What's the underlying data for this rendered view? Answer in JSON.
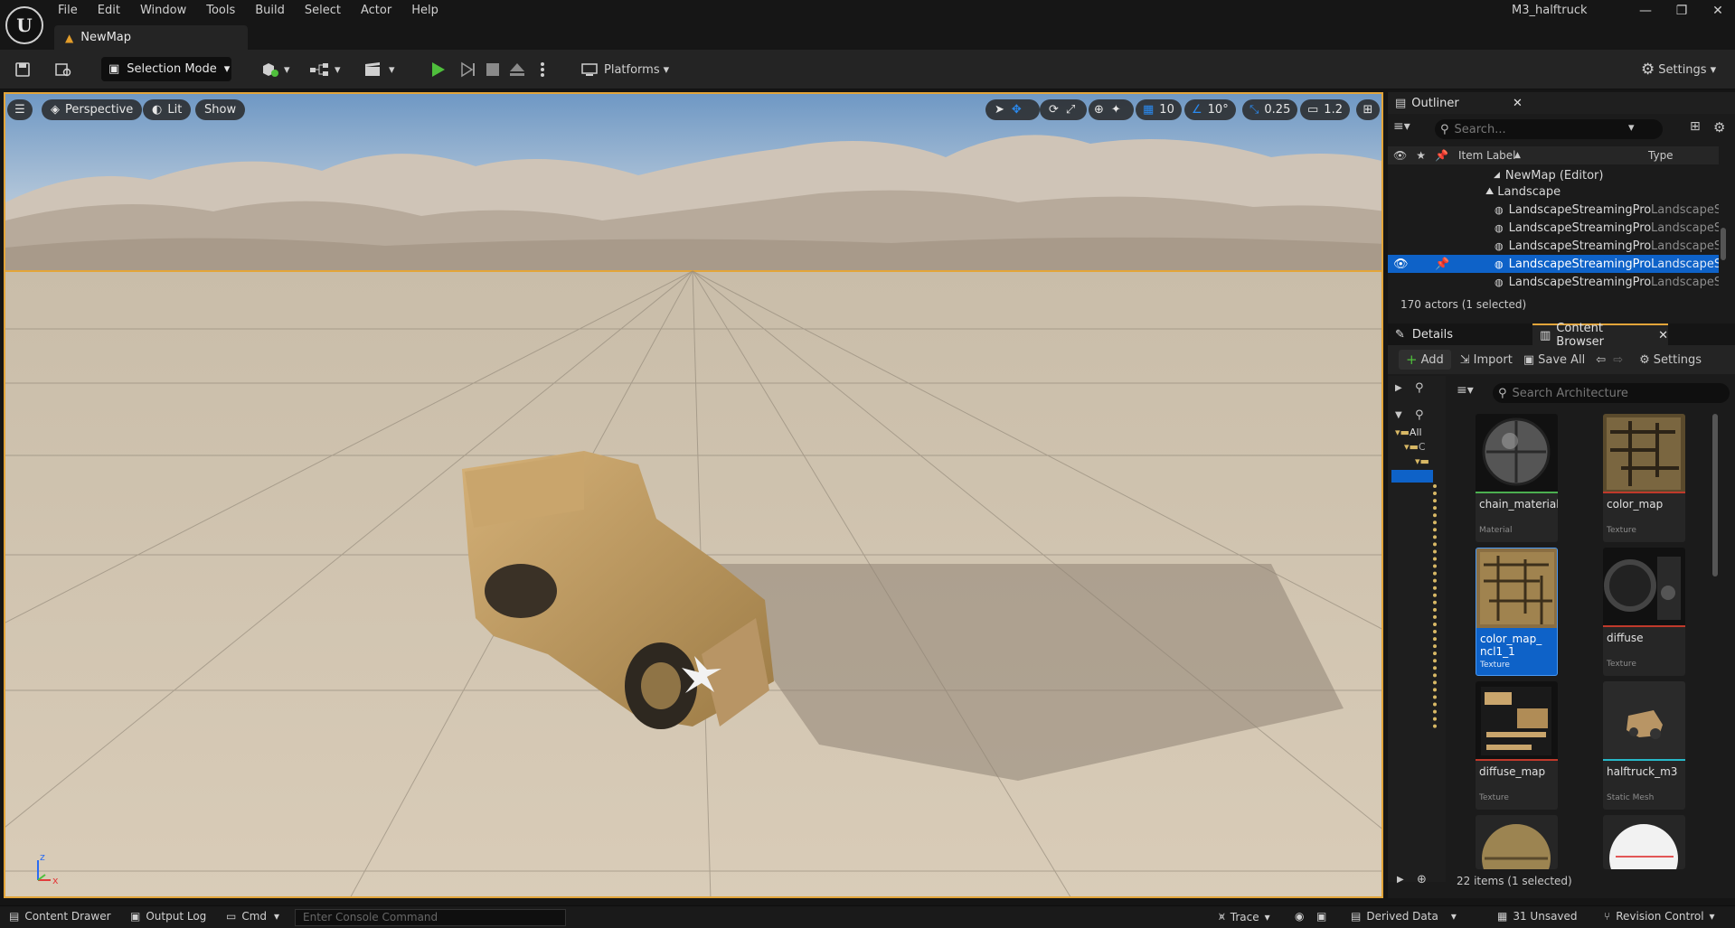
{
  "menu": [
    "File",
    "Edit",
    "Window",
    "Tools",
    "Build",
    "Select",
    "Actor",
    "Help"
  ],
  "document_tab": "NewMap",
  "project_name": "M3_halftruck",
  "toolbar": {
    "selection_mode": "Selection Mode",
    "platforms": "Platforms",
    "settings": "Settings"
  },
  "viewport": {
    "perspective": "Perspective",
    "lit": "Lit",
    "show": "Show",
    "grid_size": "10",
    "rotation_snap": "10°",
    "scale_snap": "0.25",
    "camera_speed": "1.2",
    "axis_z": "z",
    "axis_x": "x"
  },
  "outliner": {
    "title": "Outliner",
    "search_placeholder": "Search...",
    "col_label": "Item Label",
    "col_type": "Type",
    "rows": [
      {
        "label": "NewMap (Editor)",
        "type": ""
      },
      {
        "label": "Landscape",
        "type": ""
      },
      {
        "label": "LandscapeStreamingPro",
        "type": "LandscapeSt"
      },
      {
        "label": "LandscapeStreamingPro",
        "type": "LandscapeSt"
      },
      {
        "label": "LandscapeStreamingPro",
        "type": "LandscapeSt"
      },
      {
        "label": "LandscapeStreamingPro",
        "type": "LandscapeSt"
      },
      {
        "label": "LandscapeStreamingPro",
        "type": "LandscapeSt"
      }
    ],
    "status": "170 actors (1 selected)"
  },
  "tabs": {
    "details": "Details",
    "content_browser": "Content Browser"
  },
  "content_browser": {
    "add": "Add",
    "import": "Import",
    "save_all": "Save All",
    "settings": "Settings",
    "search_placeholder": "Search Architecture",
    "tree_all": "All",
    "tree_c": "C",
    "assets": [
      {
        "name": "chain_material",
        "type": "Material",
        "color": "#4caf50"
      },
      {
        "name": "color_map",
        "type": "Texture",
        "color": "#c0392b"
      },
      {
        "name": "color_map_\nncl1_1",
        "type": "Texture",
        "color": "#c0392b"
      },
      {
        "name": "diffuse",
        "type": "Texture",
        "color": "#c0392b"
      },
      {
        "name": "diffuse_map",
        "type": "Texture",
        "color": "#c0392b"
      },
      {
        "name": "halftruck_m3",
        "type": "Static Mesh",
        "color": "#27b8c8"
      }
    ],
    "status": "22 items (1 selected)"
  },
  "statusbar": {
    "content_drawer": "Content Drawer",
    "output_log": "Output Log",
    "cmd": "Cmd",
    "console_placeholder": "Enter Console Command",
    "trace": "Trace",
    "derived_data": "Derived Data",
    "unsaved": "31 Unsaved",
    "revision_control": "Revision Control"
  },
  "colors": {
    "accent_orange": "#e3a53a",
    "selection_blue": "#0e62c8",
    "play_green": "#4fbf3c"
  }
}
